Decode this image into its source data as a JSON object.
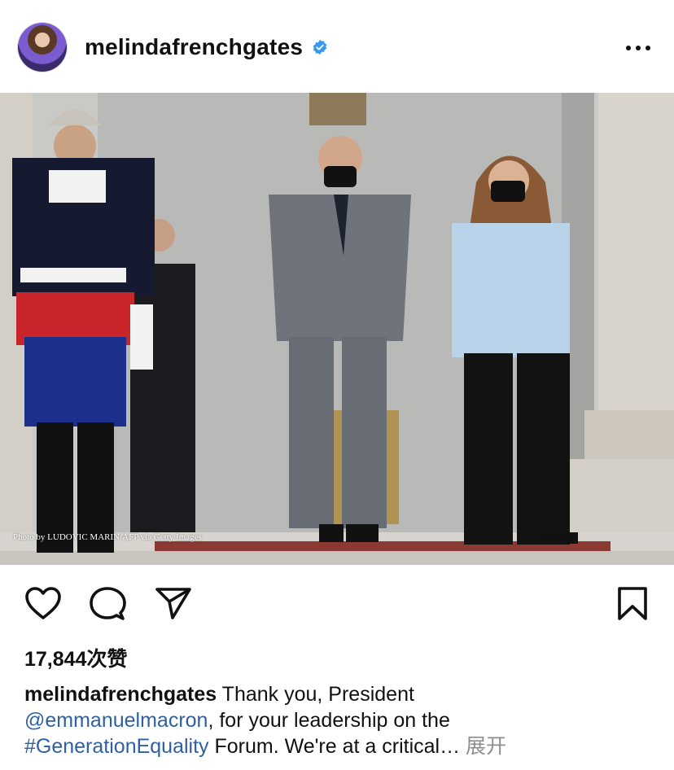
{
  "post": {
    "username": "melindafrenchgates",
    "verified": true,
    "photo_credit": "Photo by LUDOVIC MARIN/AFP via Getty Images",
    "likes_count": "17,844",
    "likes_suffix": "次赞",
    "caption": {
      "author": "melindafrenchgates",
      "text_1": " Thank you, President",
      "mention": "@emmanuelmacron",
      "text_2": ", for your leadership on the",
      "hashtag": "#GenerationEquality",
      "text_3": " Forum. We're at a critical…",
      "expand_label": "展开"
    }
  },
  "icons": {
    "more": "more-horizontal-icon",
    "like": "heart-icon",
    "comment": "comment-icon",
    "share": "share-icon",
    "save": "bookmark-icon",
    "verified": "verified-badge-icon"
  },
  "colors": {
    "link": "#2f5fa5",
    "verified": "#3897f0",
    "muted": "#8e8e8e"
  }
}
